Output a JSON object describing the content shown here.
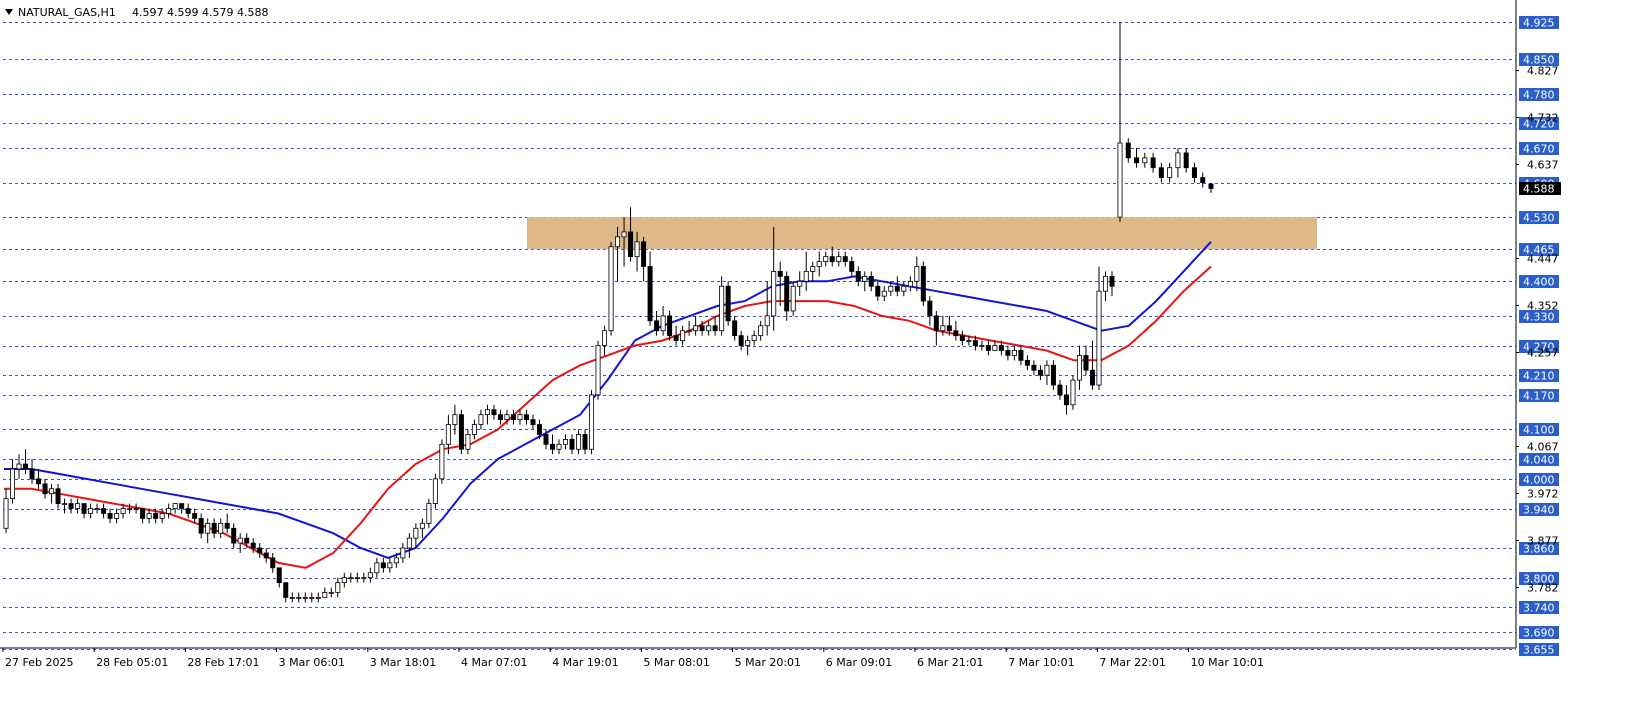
{
  "header": {
    "symbol": "NATURAL_GAS,H1",
    "ohlc": "4.597 4.599 4.579 4.588"
  },
  "colors": {
    "background": "#ffffff",
    "grid_dashed": "#3355cc",
    "label_bg": "#2c5ec9",
    "label_text": "#ffffff",
    "zone_fill": "#deb887",
    "ma_fast": "#1414d8",
    "ma_slow": "#e81414",
    "candle_up_fill": "#ffffff",
    "candle_down_fill": "#000000",
    "candle_stroke": "#000000",
    "current_price_bg": "#000000"
  },
  "chart_data": {
    "type": "candlestick",
    "title": "NATURAL_GAS,H1",
    "x_tick_labels": [
      "27 Feb 2025",
      "28 Feb 05:01",
      "28 Feb 17:01",
      "3 Mar 06:01",
      "3 Mar 18:01",
      "4 Mar 07:01",
      "4 Mar 19:01",
      "5 Mar 08:01",
      "5 Mar 20:01",
      "6 Mar 09:01",
      "6 Mar 21:01",
      "7 Mar 10:01",
      "7 Mar 22:01",
      "10 Mar 10:01"
    ],
    "y_range": [
      3.655,
      4.95
    ],
    "y_plain_ticks": [
      4.827,
      4.732,
      4.637,
      4.447,
      4.352,
      4.257,
      4.067,
      3.972,
      3.877,
      3.782
    ],
    "level_labels": [
      4.925,
      4.85,
      4.78,
      4.72,
      4.67,
      4.6,
      4.53,
      4.465,
      4.4,
      4.33,
      4.27,
      4.21,
      4.17,
      4.1,
      4.04,
      4.0,
      3.94,
      3.86,
      3.8,
      3.74,
      3.69,
      3.655
    ],
    "current_price": 4.588,
    "zone": {
      "low": 4.465,
      "high": 4.53,
      "start_index": 116,
      "end_index": 285
    },
    "candles": [
      [
        3.9,
        3.98,
        3.89,
        3.96
      ],
      [
        3.96,
        4.04,
        3.95,
        4.02
      ],
      [
        4.02,
        4.05,
        4.0,
        4.03
      ],
      [
        4.03,
        4.06,
        4.01,
        4.02
      ],
      [
        4.02,
        4.04,
        3.99,
        4.0
      ],
      [
        4.0,
        4.02,
        3.98,
        3.99
      ],
      [
        3.99,
        4.0,
        3.96,
        3.97
      ],
      [
        3.97,
        3.99,
        3.95,
        3.98
      ],
      [
        3.98,
        3.99,
        3.94,
        3.95
      ],
      [
        3.95,
        3.96,
        3.93,
        3.95
      ],
      [
        3.95,
        3.96,
        3.93,
        3.94
      ],
      [
        3.94,
        3.96,
        3.93,
        3.95
      ],
      [
        3.95,
        3.95,
        3.92,
        3.93
      ],
      [
        3.93,
        3.95,
        3.92,
        3.94
      ],
      [
        3.94,
        3.95,
        3.93,
        3.94
      ],
      [
        3.94,
        3.95,
        3.92,
        3.93
      ],
      [
        3.93,
        3.94,
        3.91,
        3.92
      ],
      [
        3.92,
        3.94,
        3.91,
        3.93
      ],
      [
        3.93,
        3.95,
        3.92,
        3.94
      ],
      [
        3.94,
        3.95,
        3.93,
        3.94
      ],
      [
        3.94,
        3.95,
        3.93,
        3.94
      ],
      [
        3.94,
        3.94,
        3.91,
        3.92
      ],
      [
        3.92,
        3.94,
        3.91,
        3.93
      ],
      [
        3.93,
        3.94,
        3.91,
        3.92
      ],
      [
        3.92,
        3.94,
        3.91,
        3.93
      ],
      [
        3.93,
        3.95,
        3.92,
        3.94
      ],
      [
        3.94,
        3.95,
        3.93,
        3.95
      ],
      [
        3.95,
        3.95,
        3.93,
        3.94
      ],
      [
        3.94,
        3.95,
        3.92,
        3.93
      ],
      [
        3.93,
        3.94,
        3.91,
        3.92
      ],
      [
        3.92,
        3.93,
        3.88,
        3.89
      ],
      [
        3.89,
        3.92,
        3.87,
        3.91
      ],
      [
        3.91,
        3.92,
        3.88,
        3.89
      ],
      [
        3.89,
        3.92,
        3.88,
        3.91
      ],
      [
        3.91,
        3.93,
        3.89,
        3.9
      ],
      [
        3.9,
        3.91,
        3.86,
        3.87
      ],
      [
        3.87,
        3.89,
        3.85,
        3.88
      ],
      [
        3.88,
        3.89,
        3.86,
        3.87
      ],
      [
        3.87,
        3.88,
        3.85,
        3.86
      ],
      [
        3.86,
        3.87,
        3.84,
        3.85
      ],
      [
        3.85,
        3.86,
        3.83,
        3.84
      ],
      [
        3.84,
        3.85,
        3.81,
        3.82
      ],
      [
        3.82,
        3.82,
        3.78,
        3.79
      ],
      [
        3.79,
        3.79,
        3.75,
        3.76
      ],
      [
        3.76,
        3.77,
        3.75,
        3.76
      ],
      [
        3.76,
        3.77,
        3.75,
        3.76
      ],
      [
        3.76,
        3.77,
        3.75,
        3.76
      ],
      [
        3.76,
        3.77,
        3.75,
        3.76
      ],
      [
        3.76,
        3.77,
        3.75,
        3.76
      ],
      [
        3.76,
        3.78,
        3.76,
        3.77
      ],
      [
        3.77,
        3.78,
        3.76,
        3.77
      ],
      [
        3.77,
        3.8,
        3.76,
        3.79
      ],
      [
        3.79,
        3.81,
        3.78,
        3.8
      ],
      [
        3.8,
        3.81,
        3.79,
        3.8
      ],
      [
        3.8,
        3.81,
        3.79,
        3.8
      ],
      [
        3.8,
        3.81,
        3.79,
        3.8
      ],
      [
        3.8,
        3.82,
        3.79,
        3.81
      ],
      [
        3.81,
        3.84,
        3.8,
        3.83
      ],
      [
        3.83,
        3.84,
        3.81,
        3.82
      ],
      [
        3.82,
        3.84,
        3.81,
        3.83
      ],
      [
        3.83,
        3.85,
        3.82,
        3.84
      ],
      [
        3.84,
        3.87,
        3.83,
        3.86
      ],
      [
        3.86,
        3.89,
        3.84,
        3.88
      ],
      [
        3.88,
        3.91,
        3.86,
        3.9
      ],
      [
        3.9,
        3.92,
        3.88,
        3.91
      ],
      [
        3.91,
        3.96,
        3.9,
        3.95
      ],
      [
        3.95,
        4.01,
        3.94,
        4.0
      ],
      [
        4.0,
        4.08,
        3.99,
        4.07
      ],
      [
        4.07,
        4.13,
        4.05,
        4.11
      ],
      [
        4.11,
        4.15,
        4.09,
        4.13
      ],
      [
        4.13,
        4.14,
        4.05,
        4.06
      ],
      [
        4.06,
        4.1,
        4.05,
        4.09
      ],
      [
        4.09,
        4.12,
        4.08,
        4.11
      ],
      [
        4.11,
        4.14,
        4.1,
        4.13
      ],
      [
        4.13,
        4.15,
        4.11,
        4.14
      ],
      [
        4.14,
        4.15,
        4.12,
        4.13
      ],
      [
        4.13,
        4.14,
        4.11,
        4.12
      ],
      [
        4.12,
        4.14,
        4.11,
        4.13
      ],
      [
        4.13,
        4.14,
        4.11,
        4.12
      ],
      [
        4.12,
        4.14,
        4.11,
        4.13
      ],
      [
        4.13,
        4.14,
        4.11,
        4.12
      ],
      [
        4.12,
        4.13,
        4.1,
        4.11
      ],
      [
        4.11,
        4.12,
        4.08,
        4.09
      ],
      [
        4.09,
        4.1,
        4.06,
        4.07
      ],
      [
        4.07,
        4.09,
        4.05,
        4.06
      ],
      [
        4.06,
        4.08,
        4.05,
        4.07
      ],
      [
        4.07,
        4.09,
        4.06,
        4.08
      ],
      [
        4.08,
        4.09,
        4.05,
        4.06
      ],
      [
        4.06,
        4.1,
        4.05,
        4.09
      ],
      [
        4.09,
        4.1,
        4.05,
        4.06
      ],
      [
        4.06,
        4.18,
        4.05,
        4.17
      ],
      [
        4.17,
        4.28,
        4.16,
        4.27
      ],
      [
        4.27,
        4.31,
        4.25,
        4.3
      ],
      [
        4.3,
        4.48,
        4.29,
        4.47
      ],
      [
        4.47,
        4.51,
        4.4,
        4.49
      ],
      [
        4.49,
        4.53,
        4.43,
        4.5
      ],
      [
        4.5,
        4.55,
        4.44,
        4.45
      ],
      [
        4.45,
        4.5,
        4.42,
        4.48
      ],
      [
        4.48,
        4.49,
        4.4,
        4.43
      ],
      [
        4.43,
        4.46,
        4.31,
        4.32
      ],
      [
        4.32,
        4.34,
        4.29,
        4.3
      ],
      [
        4.3,
        4.35,
        4.29,
        4.33
      ],
      [
        4.33,
        4.34,
        4.28,
        4.29
      ],
      [
        4.29,
        4.31,
        4.27,
        4.28
      ],
      [
        4.28,
        4.31,
        4.27,
        4.3
      ],
      [
        4.3,
        4.32,
        4.29,
        4.3
      ],
      [
        4.3,
        4.33,
        4.29,
        4.31
      ],
      [
        4.31,
        4.32,
        4.29,
        4.3
      ],
      [
        4.3,
        4.32,
        4.29,
        4.31
      ],
      [
        4.31,
        4.33,
        4.29,
        4.3
      ],
      [
        4.3,
        4.41,
        4.29,
        4.39
      ],
      [
        4.39,
        4.4,
        4.31,
        4.32
      ],
      [
        4.32,
        4.33,
        4.28,
        4.29
      ],
      [
        4.29,
        4.3,
        4.26,
        4.27
      ],
      [
        4.27,
        4.29,
        4.25,
        4.28
      ],
      [
        4.28,
        4.3,
        4.27,
        4.29
      ],
      [
        4.29,
        4.32,
        4.28,
        4.31
      ],
      [
        4.31,
        4.4,
        4.29,
        4.33
      ],
      [
        4.33,
        4.51,
        4.3,
        4.42
      ],
      [
        4.42,
        4.44,
        4.35,
        4.41
      ],
      [
        4.41,
        4.42,
        4.32,
        4.34
      ],
      [
        4.34,
        4.4,
        4.33,
        4.39
      ],
      [
        4.39,
        4.42,
        4.37,
        4.4
      ],
      [
        4.4,
        4.46,
        4.38,
        4.42
      ],
      [
        4.42,
        4.44,
        4.4,
        4.43
      ],
      [
        4.43,
        4.46,
        4.41,
        4.44
      ],
      [
        4.44,
        4.46,
        4.43,
        4.45
      ],
      [
        4.45,
        4.47,
        4.43,
        4.44
      ],
      [
        4.44,
        4.46,
        4.43,
        4.45
      ],
      [
        4.45,
        4.46,
        4.43,
        4.44
      ],
      [
        4.44,
        4.45,
        4.41,
        4.42
      ],
      [
        4.42,
        4.43,
        4.39,
        4.4
      ],
      [
        4.4,
        4.42,
        4.38,
        4.41
      ],
      [
        4.41,
        4.42,
        4.38,
        4.39
      ],
      [
        4.39,
        4.4,
        4.36,
        4.37
      ],
      [
        4.37,
        4.39,
        4.36,
        4.38
      ],
      [
        4.38,
        4.4,
        4.37,
        4.39
      ],
      [
        4.39,
        4.41,
        4.37,
        4.38
      ],
      [
        4.38,
        4.4,
        4.37,
        4.39
      ],
      [
        4.39,
        4.41,
        4.38,
        4.4
      ],
      [
        4.4,
        4.45,
        4.38,
        4.43
      ],
      [
        4.43,
        4.44,
        4.35,
        4.36
      ],
      [
        4.36,
        4.37,
        4.31,
        4.33
      ],
      [
        4.33,
        4.34,
        4.27,
        4.3
      ],
      [
        4.3,
        4.33,
        4.29,
        4.31
      ],
      [
        4.31,
        4.33,
        4.29,
        4.3
      ],
      [
        4.3,
        4.32,
        4.28,
        4.29
      ],
      [
        4.29,
        4.3,
        4.27,
        4.28
      ],
      [
        4.28,
        4.29,
        4.27,
        4.28
      ],
      [
        4.28,
        4.29,
        4.26,
        4.27
      ],
      [
        4.27,
        4.28,
        4.26,
        4.27
      ],
      [
        4.27,
        4.28,
        4.25,
        4.26
      ],
      [
        4.26,
        4.28,
        4.26,
        4.27
      ],
      [
        4.27,
        4.28,
        4.25,
        4.26
      ],
      [
        4.26,
        4.27,
        4.24,
        4.25
      ],
      [
        4.25,
        4.27,
        4.24,
        4.26
      ],
      [
        4.26,
        4.27,
        4.23,
        4.24
      ],
      [
        4.24,
        4.25,
        4.22,
        4.23
      ],
      [
        4.23,
        4.24,
        4.21,
        4.22
      ],
      [
        4.22,
        4.23,
        4.2,
        4.21
      ],
      [
        4.21,
        4.24,
        4.19,
        4.23
      ],
      [
        4.23,
        4.24,
        4.18,
        4.19
      ],
      [
        4.19,
        4.2,
        4.16,
        4.17
      ],
      [
        4.17,
        4.19,
        4.13,
        4.15
      ],
      [
        4.15,
        4.21,
        4.14,
        4.2
      ],
      [
        4.2,
        4.27,
        4.18,
        4.25
      ],
      [
        4.25,
        4.27,
        4.21,
        4.22
      ],
      [
        4.22,
        4.28,
        4.18,
        4.19
      ],
      [
        4.19,
        4.43,
        4.18,
        4.38
      ],
      [
        4.38,
        4.42,
        4.36,
        4.41
      ],
      [
        4.41,
        4.42,
        4.37,
        4.39
      ],
      [
        4.53,
        4.925,
        4.52,
        4.68
      ],
      [
        4.68,
        4.69,
        4.64,
        4.65
      ],
      [
        4.65,
        4.67,
        4.63,
        4.64
      ],
      [
        4.64,
        4.66,
        4.63,
        4.65
      ],
      [
        4.65,
        4.66,
        4.62,
        4.63
      ],
      [
        4.63,
        4.64,
        4.6,
        4.61
      ],
      [
        4.61,
        4.64,
        4.6,
        4.63
      ],
      [
        4.63,
        4.67,
        4.61,
        4.66
      ],
      [
        4.66,
        4.67,
        4.62,
        4.63
      ],
      [
        4.63,
        4.64,
        4.6,
        4.61
      ],
      [
        4.61,
        4.62,
        4.59,
        4.6
      ],
      [
        4.597,
        4.599,
        4.579,
        4.588
      ]
    ],
    "ma_fast_values": [
      4.02,
      4.02,
      4.01,
      4.0,
      3.99,
      3.98,
      3.97,
      3.96,
      3.95,
      3.94,
      3.93,
      3.91,
      3.89,
      3.86,
      3.84,
      3.86,
      3.92,
      3.99,
      4.04,
      4.07,
      4.1,
      4.13,
      4.2,
      4.28,
      4.31,
      4.33,
      4.35,
      4.36,
      4.39,
      4.4,
      4.4,
      4.41,
      4.4,
      4.39,
      4.38,
      4.37,
      4.36,
      4.35,
      4.34,
      4.32,
      4.3,
      4.31,
      4.36,
      4.42,
      4.48
    ],
    "ma_slow_values": [
      3.98,
      3.98,
      3.97,
      3.96,
      3.95,
      3.94,
      3.93,
      3.91,
      3.89,
      3.86,
      3.83,
      3.82,
      3.85,
      3.91,
      3.98,
      4.03,
      4.06,
      4.07,
      4.1,
      4.15,
      4.2,
      4.23,
      4.25,
      4.27,
      4.28,
      4.3,
      4.33,
      4.35,
      4.36,
      4.36,
      4.36,
      4.35,
      4.33,
      4.32,
      4.3,
      4.29,
      4.28,
      4.27,
      4.26,
      4.24,
      4.24,
      4.27,
      4.32,
      4.38,
      4.43
    ]
  }
}
